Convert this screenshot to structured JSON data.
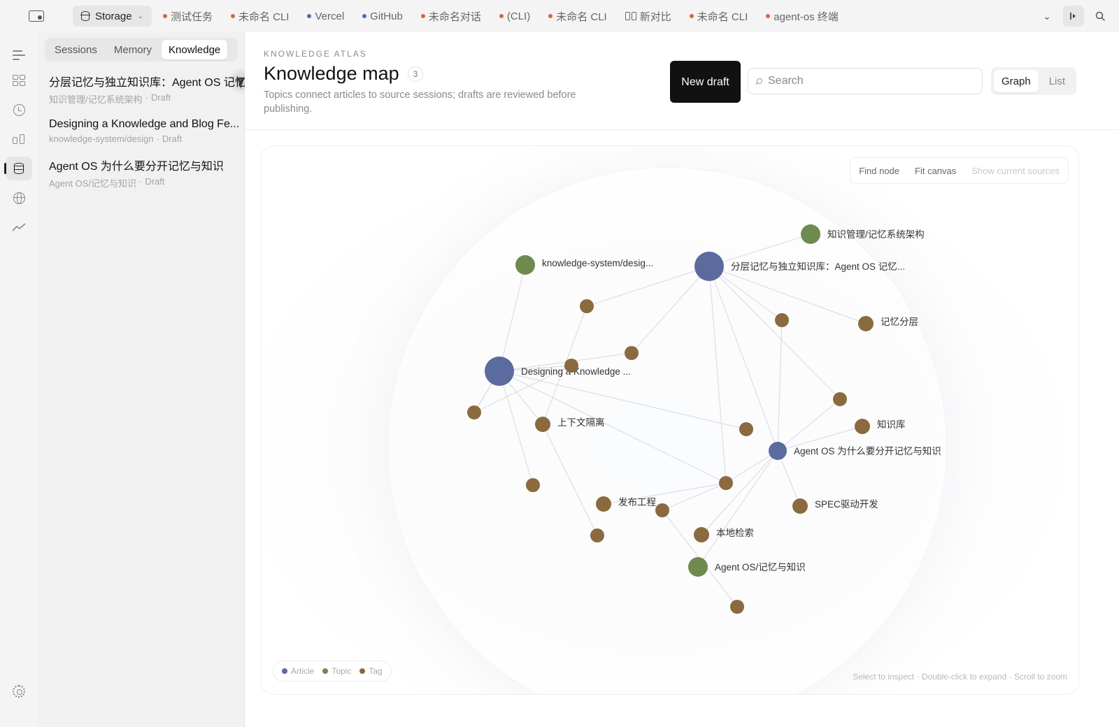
{
  "colors": {
    "article": "#5b6b9e",
    "topic": "#6e8a4e",
    "tag": "#8a6a3e"
  },
  "tabbar": {
    "storage_label": "Storage",
    "tabs": [
      {
        "label": "测试任务",
        "dot": "#d9663f"
      },
      {
        "label": "未命名 CLI",
        "dot": "#d9663f"
      },
      {
        "label": "Vercel",
        "dot": "#4a6fb5"
      },
      {
        "label": "GitHub",
        "dot": "#4a6fb5"
      },
      {
        "label": "未命名对话",
        "dot": "#d9663f"
      },
      {
        "label": "(CLI)",
        "dot": "#d9663f"
      },
      {
        "label": "未命名 CLI",
        "dot": "#d9663f"
      },
      {
        "label": "新对比",
        "icon": "compare-icon"
      },
      {
        "label": "未命名 CLI",
        "dot": "#d9663f"
      },
      {
        "label": "agent-os 终端",
        "dot": "#d9663f"
      }
    ]
  },
  "rail": {
    "items": [
      "menu-icon",
      "board-icon",
      "history-icon",
      "compare-icon",
      "storage-icon",
      "globe-icon",
      "trend-icon"
    ],
    "settings": "gear-icon"
  },
  "sidebar": {
    "tabs": {
      "sessions": "Sessions",
      "memory": "Memory",
      "knowledge": "Knowledge"
    },
    "docs": [
      {
        "title": "分层记忆与独立知识库：Agent OS 记忆...",
        "path": "知识管理/记忆系统架构",
        "status": "Draft"
      },
      {
        "title": "Designing a Knowledge and Blog Fe...",
        "path": "knowledge-system/design",
        "status": "Draft"
      },
      {
        "title": "Agent OS 为什么要分开记忆与知识",
        "path": "Agent OS/记忆与知识",
        "status": "Draft"
      }
    ]
  },
  "header": {
    "eyebrow": "KNOWLEDGE ATLAS",
    "title": "Knowledge map",
    "count": "3",
    "subtitle": "Topics connect articles to source sessions; drafts are reviewed before publishing.",
    "new_draft": "New draft",
    "search_placeholder": "Search",
    "view_graph": "Graph",
    "view_list": "List"
  },
  "canvas": {
    "tools": {
      "find": "Find node",
      "fit": "Fit canvas",
      "sources": "Show current sources"
    },
    "legend": {
      "article": "Article",
      "topic": "Topic",
      "tag": "Tag"
    },
    "hint": "Select to inspect · Double-click to expand · Scroll to zoom"
  },
  "graph": {
    "nodes": [
      {
        "id": "a1",
        "type": "article",
        "label": "分层记忆与独立知识库：Agent OS 记忆..."
      },
      {
        "id": "a2",
        "type": "article",
        "label": "Designing a Knowledge ..."
      },
      {
        "id": "a3",
        "type": "article",
        "label": "Agent OS 为什么要分开记忆与知识"
      },
      {
        "id": "t1",
        "type": "topic",
        "label": "知识管理/记忆系统架构"
      },
      {
        "id": "t2",
        "type": "topic",
        "label": "knowledge-system/desig..."
      },
      {
        "id": "t3",
        "type": "topic",
        "label": "Agent OS/记忆与知识"
      },
      {
        "id": "g1",
        "type": "tag",
        "label": "记忆分层"
      },
      {
        "id": "g2",
        "type": "tag",
        "label": "知识库"
      },
      {
        "id": "g3",
        "type": "tag",
        "label": "上下文隔离"
      },
      {
        "id": "g4",
        "type": "tag",
        "label": "发布工程"
      },
      {
        "id": "g5",
        "type": "tag",
        "label": "SPEC驱动开发"
      },
      {
        "id": "g6",
        "type": "tag",
        "label": "本地检索"
      },
      {
        "id": "u1",
        "type": "tag",
        "label": ""
      },
      {
        "id": "u2",
        "type": "tag",
        "label": ""
      },
      {
        "id": "u3",
        "type": "tag",
        "label": ""
      },
      {
        "id": "u4",
        "type": "tag",
        "label": ""
      },
      {
        "id": "u5",
        "type": "tag",
        "label": ""
      },
      {
        "id": "u6",
        "type": "tag",
        "label": ""
      },
      {
        "id": "u7",
        "type": "tag",
        "label": ""
      },
      {
        "id": "u8",
        "type": "tag",
        "label": ""
      },
      {
        "id": "u9",
        "type": "tag",
        "label": ""
      },
      {
        "id": "u10",
        "type": "tag",
        "label": ""
      },
      {
        "id": "u11",
        "type": "tag",
        "label": ""
      },
      {
        "id": "u12",
        "type": "tag",
        "label": ""
      }
    ],
    "edges": [
      [
        "a1",
        "t1"
      ],
      [
        "a1",
        "g1"
      ],
      [
        "a1",
        "u1"
      ],
      [
        "a1",
        "u2"
      ],
      [
        "a1",
        "a3"
      ],
      [
        "a1",
        "u4"
      ],
      [
        "a1",
        "u3"
      ],
      [
        "a1",
        "u9"
      ],
      [
        "a2",
        "t2"
      ],
      [
        "a2",
        "u5"
      ],
      [
        "a2",
        "u6"
      ],
      [
        "a2",
        "u7"
      ],
      [
        "a2",
        "g3"
      ],
      [
        "a2",
        "u8"
      ],
      [
        "a2",
        "u3"
      ],
      [
        "a2",
        "u9"
      ],
      [
        "a2",
        "u6b"
      ],
      [
        "a3",
        "g2"
      ],
      [
        "a3",
        "g5"
      ],
      [
        "a3",
        "t3"
      ],
      [
        "a3",
        "g6"
      ],
      [
        "a3",
        "u9"
      ],
      [
        "a3",
        "u2"
      ],
      [
        "a3",
        "u1"
      ],
      [
        "u9",
        "g4"
      ],
      [
        "u9",
        "u10"
      ],
      [
        "u10",
        "u12"
      ],
      [
        "g3",
        "u11"
      ],
      [
        "g3",
        "u4"
      ],
      [
        "u5",
        "u6"
      ]
    ]
  }
}
